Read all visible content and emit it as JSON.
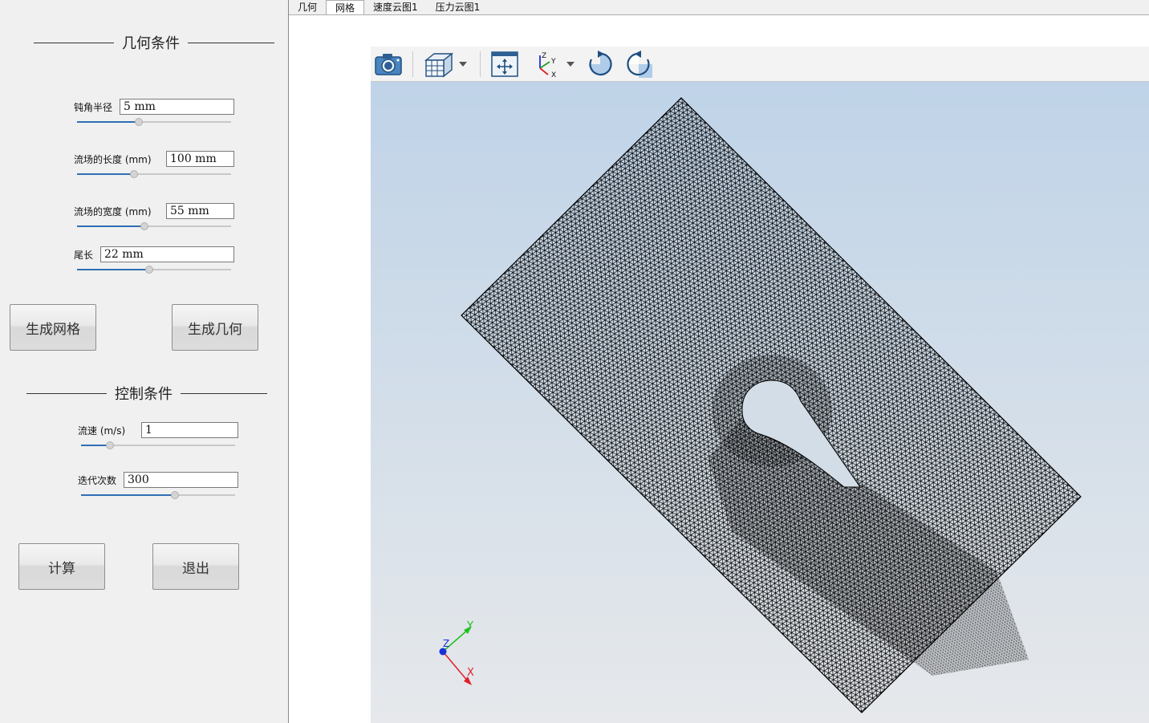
{
  "tabs": [
    "几何",
    "网格",
    "速度云图1",
    "压力云图1"
  ],
  "active_tab": 1,
  "geometry": {
    "title": "几何条件",
    "fields": [
      {
        "label": "钝角半径",
        "value": "5 mm",
        "slider": 0.4
      },
      {
        "label": "流场的长度 (mm)",
        "value": "100 mm",
        "slider": 0.37
      },
      {
        "label": "流场的宽度 (mm)",
        "value": "55 mm",
        "slider": 0.44
      },
      {
        "label": "尾长",
        "value": "22 mm",
        "slider": 0.47
      }
    ],
    "buttons": {
      "mesh": "生成网格",
      "geometry": "生成几何"
    }
  },
  "control": {
    "title": "控制条件",
    "fields": [
      {
        "label": "流速 (m/s)",
        "value": "1",
        "slider": 0.19
      },
      {
        "label": "迭代次数",
        "value": "300",
        "slider": 0.61
      }
    ],
    "buttons": {
      "compute": "计算",
      "exit": "退出"
    }
  },
  "toolbar": {
    "icons": [
      "camera-icon",
      "view-cube-icon",
      "dropdown-arrow-icon",
      "fit-all-icon",
      "axis-view-icon",
      "dropdown-arrow-icon",
      "rotate-cw-icon",
      "rotate-ccw-icon"
    ]
  },
  "triad": {
    "x": "X",
    "y": "Y",
    "z": "Z",
    "colors": {
      "x": "#e0202a",
      "y": "#22c020",
      "z": "#1a30d8"
    }
  },
  "colors": {
    "accent": "#2f6fb5",
    "mesh": "#000000"
  }
}
